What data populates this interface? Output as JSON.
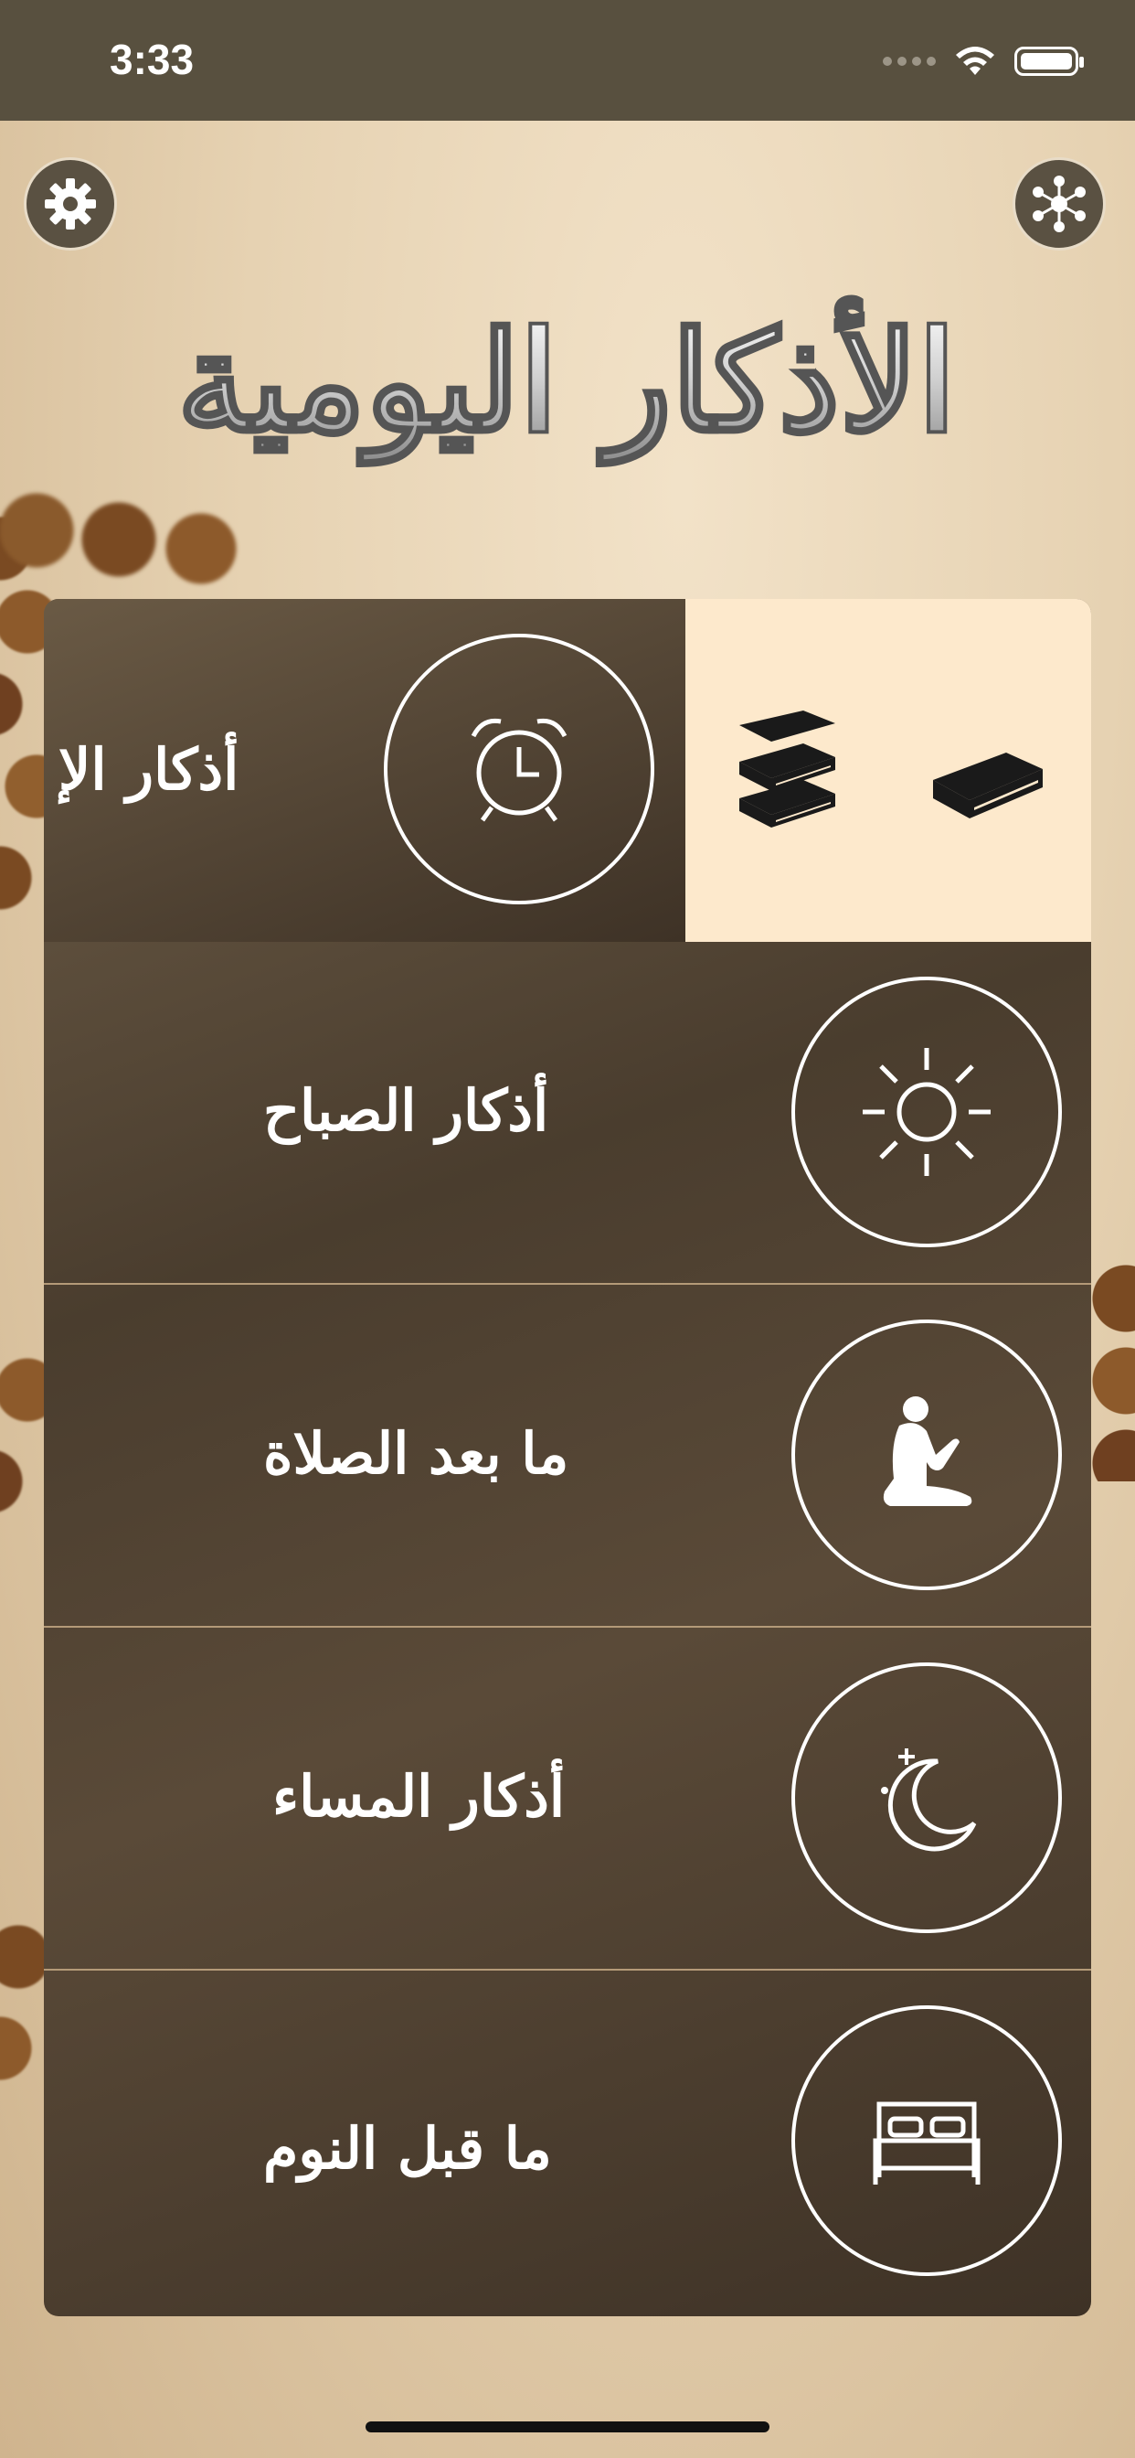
{
  "status_bar": {
    "time": "3:33"
  },
  "header": {
    "title": "الأذكار اليومية",
    "settings_icon": "gear-icon",
    "share_icon": "network-share-icon"
  },
  "menu": {
    "items": [
      {
        "label": "أذكار الإ",
        "icon": "alarm-clock-icon"
      },
      {
        "label": "أذكار الصباح",
        "icon": "sun-icon"
      },
      {
        "label": "ما بعد الصلاة",
        "icon": "praying-person-icon"
      },
      {
        "label": "أذكار المساء",
        "icon": "moon-star-icon"
      },
      {
        "label": "ما قبل النوم",
        "icon": "bed-icon"
      }
    ],
    "books": [
      {
        "icon": "books-stack-icon"
      },
      {
        "icon": "book-icon"
      }
    ]
  },
  "colors": {
    "status_bar": "#58503f",
    "panel_dark": "#4a3d2e",
    "book_bg": "#fde9cc",
    "divider": "#b49a78"
  }
}
